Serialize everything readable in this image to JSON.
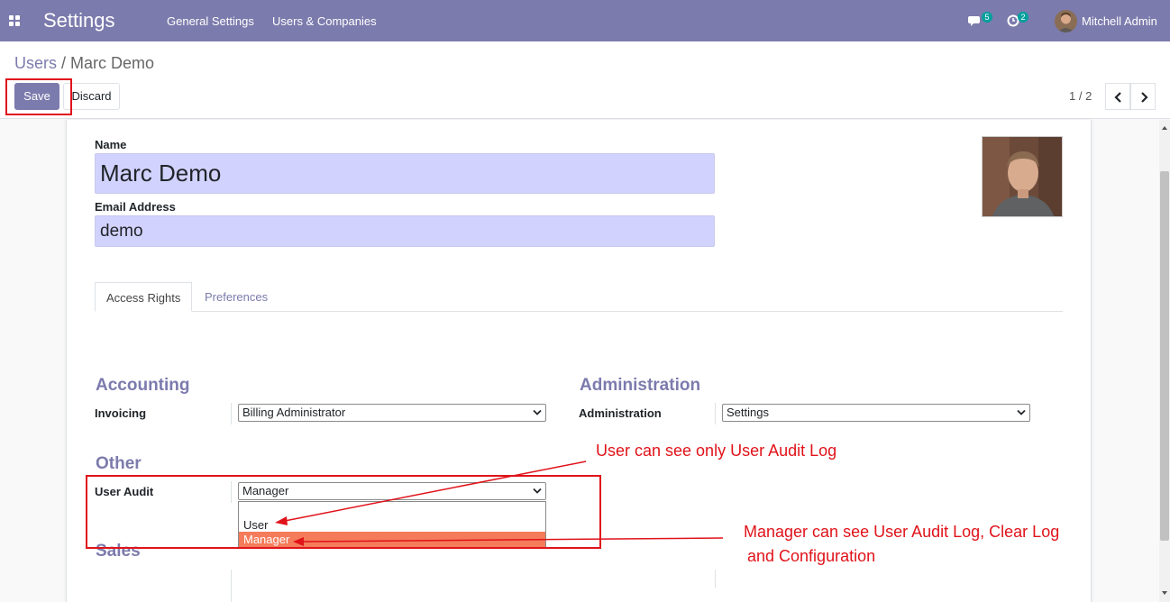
{
  "navbar": {
    "app_title": "Settings",
    "menu": [
      "General Settings",
      "Users & Companies"
    ],
    "messages_count": "5",
    "activities_count": "2",
    "user_name": "Mitchell Admin"
  },
  "breadcrumb": {
    "parent": "Users",
    "separator": " / ",
    "current": "Marc Demo"
  },
  "toolbar": {
    "save_label": "Save",
    "discard_label": "Discard"
  },
  "pager": {
    "value": "1 / 2"
  },
  "form": {
    "name_label": "Name",
    "name_value": "Marc Demo",
    "email_label": "Email Address",
    "email_value": "demo",
    "tabs": [
      "Access Rights",
      "Preferences"
    ],
    "groups": {
      "accounting": {
        "title": "Accounting",
        "field_label": "Invoicing",
        "value": "Billing Administrator"
      },
      "administration": {
        "title": "Administration",
        "field_label": "Administration",
        "value": "Settings"
      },
      "other": {
        "title": "Other",
        "field_label": "User Audit",
        "value": "Manager",
        "options": [
          "User",
          "Manager"
        ]
      },
      "sales": {
        "title": "Sales"
      }
    }
  },
  "annotations": {
    "user_note": "User can see only User Audit Log",
    "manager_note_line1": "Manager can see User Audit Log, Clear Log",
    "manager_note_line2": "and Configuration"
  },
  "colors": {
    "brand": "#7c7bad",
    "input_bg": "#d2d2ff",
    "annotation_red": "#e0131a",
    "highlight_option": "#f47c5a",
    "badge": "#00a09d"
  },
  "icons": {
    "apps": "apps-grid-icon",
    "messages": "chat-bubble-icon",
    "activities": "clock-icon",
    "pager_prev": "chevron-left-icon",
    "pager_next": "chevron-right-icon",
    "dropdown": "chevron-down-icon"
  }
}
